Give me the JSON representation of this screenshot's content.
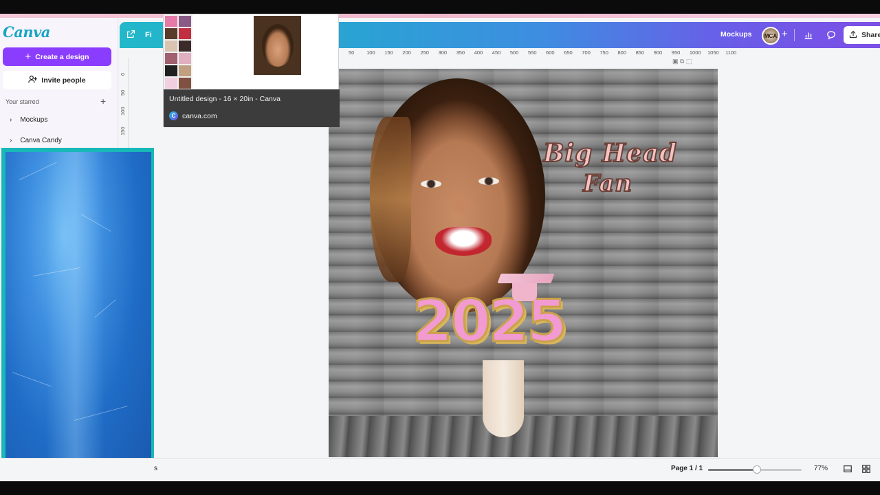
{
  "sidebar": {
    "logo": "Canva",
    "create_label": "Create a design",
    "invite_label": "Invite people",
    "starred_heading": "Your starred",
    "items": [
      {
        "label": "Mockups"
      },
      {
        "label": "Canva Candy"
      }
    ]
  },
  "header": {
    "file_label": "Fi",
    "mockups_label": "Mockups",
    "avatar_text": "MCA",
    "share_label": "Share"
  },
  "tab_preview": {
    "title": "Untitled design - 16 × 20in - Canva",
    "site": "canva.com"
  },
  "rulers": {
    "top_ticks": [
      "50",
      "100",
      "150",
      "200",
      "250",
      "300",
      "350",
      "400",
      "450",
      "500",
      "550",
      "600",
      "650",
      "700",
      "750",
      "800",
      "850",
      "900",
      "950",
      "1000",
      "1050",
      "1100"
    ],
    "left_ticks": [
      "0",
      "50",
      "100",
      "150"
    ]
  },
  "design": {
    "headline_line1": "Big Head",
    "headline_line2": "Fan",
    "year": "2025"
  },
  "footer": {
    "notes_partial": "s",
    "page_indicator": "Page 1 / 1",
    "zoom": "77%",
    "zoom_fraction": 0.52
  },
  "colors": {
    "brand_purple": "#8b3dff",
    "header_gradient_start": "#22b8c9",
    "header_gradient_end": "#7c4fe6",
    "headline_pink": "#f5c2c2",
    "year_pink": "#f29ad2"
  }
}
